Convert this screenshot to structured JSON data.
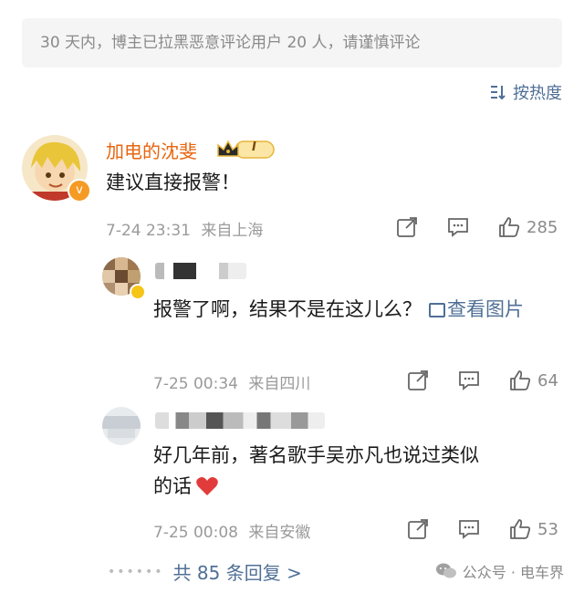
{
  "notice": "30 天内，博主已拉黑恶意评论用户 20 人，请谨慎评论",
  "sort_label": "按热度",
  "comments": [
    {
      "name": "加电的沈斐",
      "text": "建议直接报警！",
      "time": "7-24 23:31",
      "location": "来自上海",
      "likes": "285"
    },
    {
      "text": "报警了啊，结果不是在这儿么？",
      "view_image": "查看图片",
      "time": "7-25 00:34",
      "location": "来自四川",
      "likes": "64"
    },
    {
      "text_line1": "好几年前，著名歌手吴亦凡也说过类似",
      "text_line2": "的话",
      "time": "7-25 00:08",
      "location": "来自安徽",
      "likes": "53"
    }
  ],
  "more_replies": "共 85 条回复 >",
  "watermark": "公众号 · 电车界",
  "badge_level": "I",
  "colors": {
    "accent": "#4f6f96",
    "username": "#e8650e",
    "notice_bg": "#f5f5f5"
  }
}
